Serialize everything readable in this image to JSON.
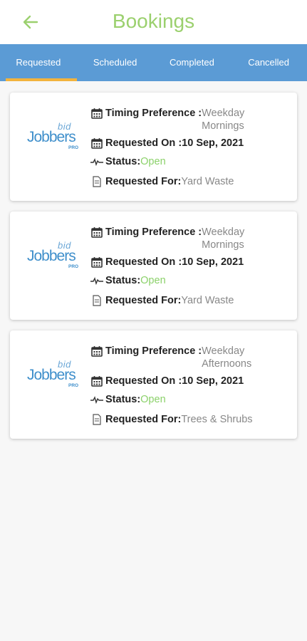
{
  "header": {
    "title": "Bookings",
    "back_icon": "arrow-left-icon",
    "accent_color": "#9bd06e"
  },
  "tabs": [
    {
      "label": "Requested",
      "active": true
    },
    {
      "label": "Scheduled",
      "active": false
    },
    {
      "label": "Completed",
      "active": false
    },
    {
      "label": "Cancelled",
      "active": false
    }
  ],
  "tab_bar_color": "#5b9bd5",
  "tab_indicator_color": "#f2b33d",
  "logo": {
    "text_bid": "bid",
    "text_jobbers": "Jobbers",
    "text_pro": "PRO"
  },
  "labels": {
    "timing": "Timing Preference :",
    "requested_on": "Requested On :",
    "status": "Status:",
    "requested_for": "Requested For:"
  },
  "bookings": [
    {
      "timing": "Weekday\nMornings",
      "requested_on": "10 Sep, 2021",
      "status": "Open",
      "requested_for": "Yard Waste"
    },
    {
      "timing": "Weekday\nMornings",
      "requested_on": "10 Sep, 2021",
      "status": "Open",
      "requested_for": "Yard Waste"
    },
    {
      "timing": "Weekday\nAfternoons",
      "requested_on": "10 Sep, 2021",
      "status": "Open",
      "requested_for": "Trees & Shrubs"
    }
  ],
  "status_color": "#8bd16a"
}
